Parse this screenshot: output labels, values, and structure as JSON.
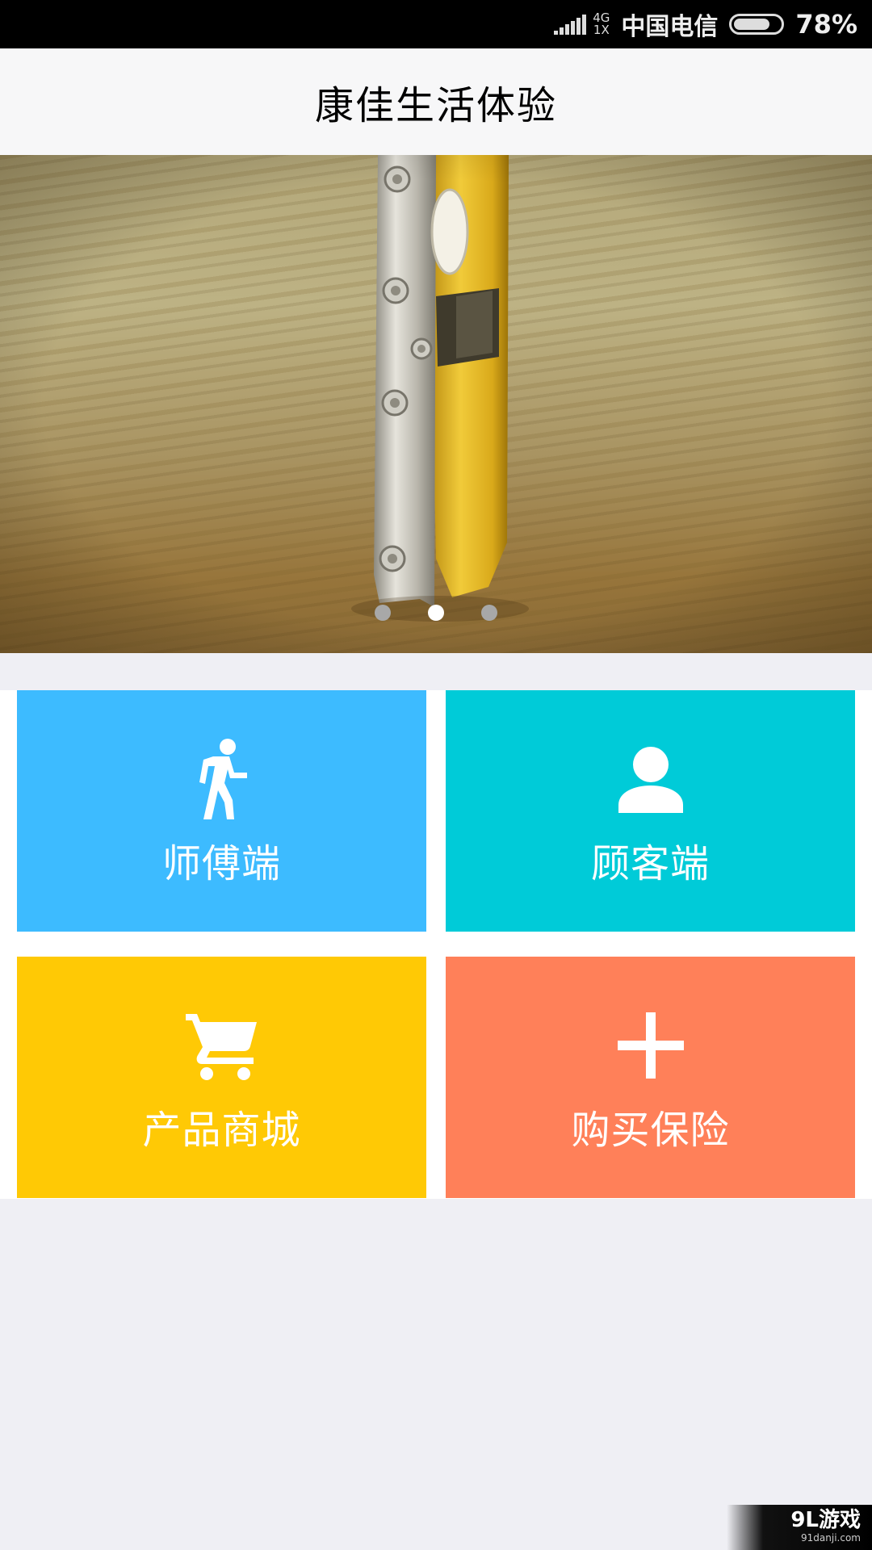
{
  "status_bar": {
    "network_top": "4G",
    "network_bottom": "1X",
    "carrier": "中国电信",
    "battery_level": 0.78,
    "battery_percent": "78%"
  },
  "header": {
    "title": "康佳生活体验"
  },
  "banner": {
    "slide_count": 3,
    "active_slide": 1
  },
  "tiles": [
    {
      "label": "师傅端",
      "icon": "walking-person-icon",
      "color": "#3dbbff"
    },
    {
      "label": "顾客端",
      "icon": "person-icon",
      "color": "#00cbd8"
    },
    {
      "label": "产品商城",
      "icon": "shopping-cart-icon",
      "color": "#ffc905"
    },
    {
      "label": "购买保险",
      "icon": "plus-icon",
      "color": "#ff8059"
    }
  ],
  "watermark": {
    "main": "9L游戏",
    "sub": "91danji.com"
  }
}
